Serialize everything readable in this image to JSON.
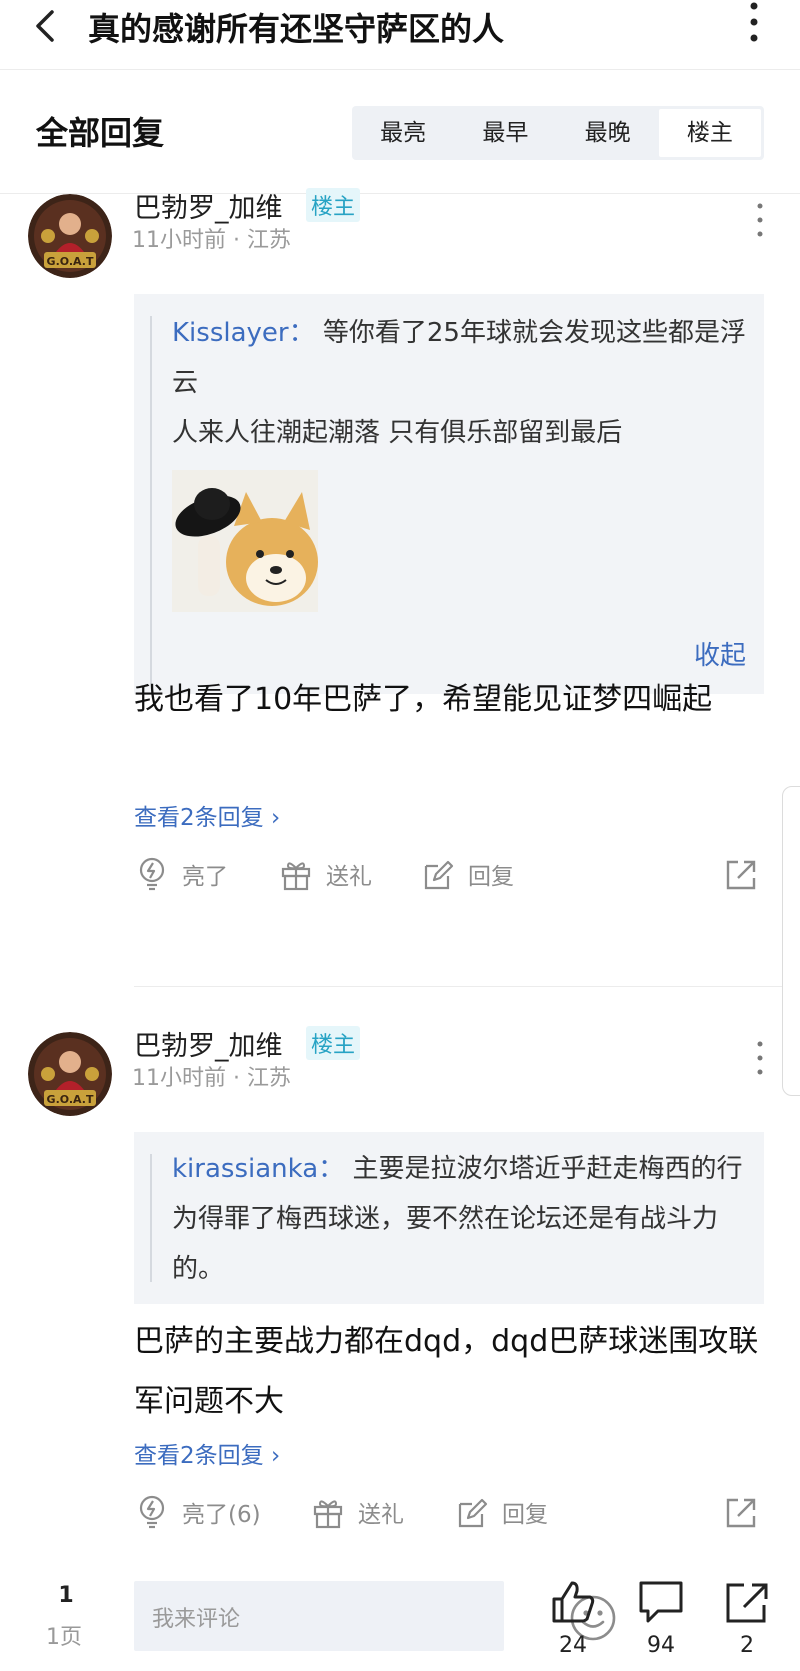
{
  "topbar": {
    "title": "真的感谢所有还坚守萨区的人"
  },
  "reply_header": {
    "title": "全部回复",
    "sort_tabs": [
      {
        "label": "最亮"
      },
      {
        "label": "最早"
      },
      {
        "label": "最晚"
      },
      {
        "label": "楼主",
        "active": true
      }
    ]
  },
  "comments": [
    {
      "username": "巴勃罗_加维",
      "badge": "楼主",
      "meta": "11小时前 · 江苏",
      "quote": {
        "author": "Kisslayer：",
        "text": "等你看了25年球就会发现这些都是浮云",
        "text2": "人来人往潮起潮落 只有俱乐部留到最后",
        "collapse": "收起"
      },
      "body": "我也看了10年巴萨了，希望能见证梦四崛起",
      "view_replies": "查看2条回复",
      "actions": {
        "like": "亮了",
        "gift": "送礼",
        "reply": "回复"
      }
    },
    {
      "username": "巴勃罗_加维",
      "badge": "楼主",
      "meta": "11小时前 · 江苏",
      "quote": {
        "author": "kirassianka：",
        "text": "主要是拉波尔塔近乎赶走梅西的行为得罪了梅西球迷，要不然在论坛还是有战斗力的。"
      },
      "body": "巴萨的主要战力都在dqd，dqd巴萨球迷围攻联军问题不大",
      "view_replies": "查看2条回复",
      "actions": {
        "like": "亮了(6)",
        "gift": "送礼",
        "reply": "回复"
      }
    }
  ],
  "bottom_bar": {
    "page_number": "1",
    "page_label": "1页",
    "input_placeholder": "我来评论",
    "like_count": "24",
    "comment_count": "94",
    "share_count": "2"
  },
  "colors": {
    "link": "#3c6cbf",
    "badge": "#27a3c4",
    "muted": "#9a9a9a",
    "quote_bg": "#f2f4f7"
  }
}
